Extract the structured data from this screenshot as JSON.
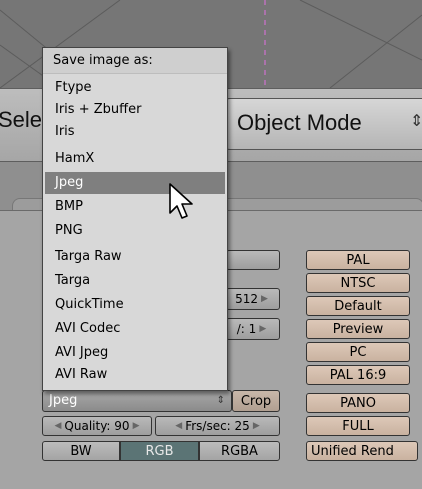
{
  "header": {
    "select_menu_label": "Sele",
    "mode_label": "Object Mode",
    "mode_arrows": "⇕"
  },
  "dropdown": {
    "title": "Save image as:",
    "items": [
      {
        "label": "Ftype"
      },
      {
        "label": "Iris + Zbuffer"
      },
      {
        "label": "Iris"
      },
      {
        "label": "HamX"
      },
      {
        "label": "Jpeg",
        "selected": true
      },
      {
        "label": "BMP"
      },
      {
        "label": "PNG"
      },
      {
        "label": "Targa Raw"
      },
      {
        "label": "Targa"
      },
      {
        "label": "QuickTime"
      },
      {
        "label": "AVI Codec"
      },
      {
        "label": "AVI Jpeg"
      },
      {
        "label": "AVI Raw"
      }
    ]
  },
  "format": {
    "current_value": "Jpeg",
    "crop_label": "Crop",
    "quality_label": "Quality: 90",
    "frs_label": "Frs/sec: 25"
  },
  "fields": {
    "size_value": "512",
    "partial_value": "/: 1"
  },
  "color_modes": {
    "bw": "BW",
    "rgb": "RGB",
    "rgba": "RGBA",
    "active": "RGB"
  },
  "presets": [
    "PAL",
    "NTSC",
    "Default",
    "Preview",
    "PC",
    "PAL 16:9",
    "PANO",
    "FULL",
    "Unified Rend"
  ],
  "colors": {
    "selection": "#7f7f7f",
    "preset_button": "#d3bcaa",
    "active_toggle": "#5b7475",
    "viewport_line": "#e070e0"
  }
}
